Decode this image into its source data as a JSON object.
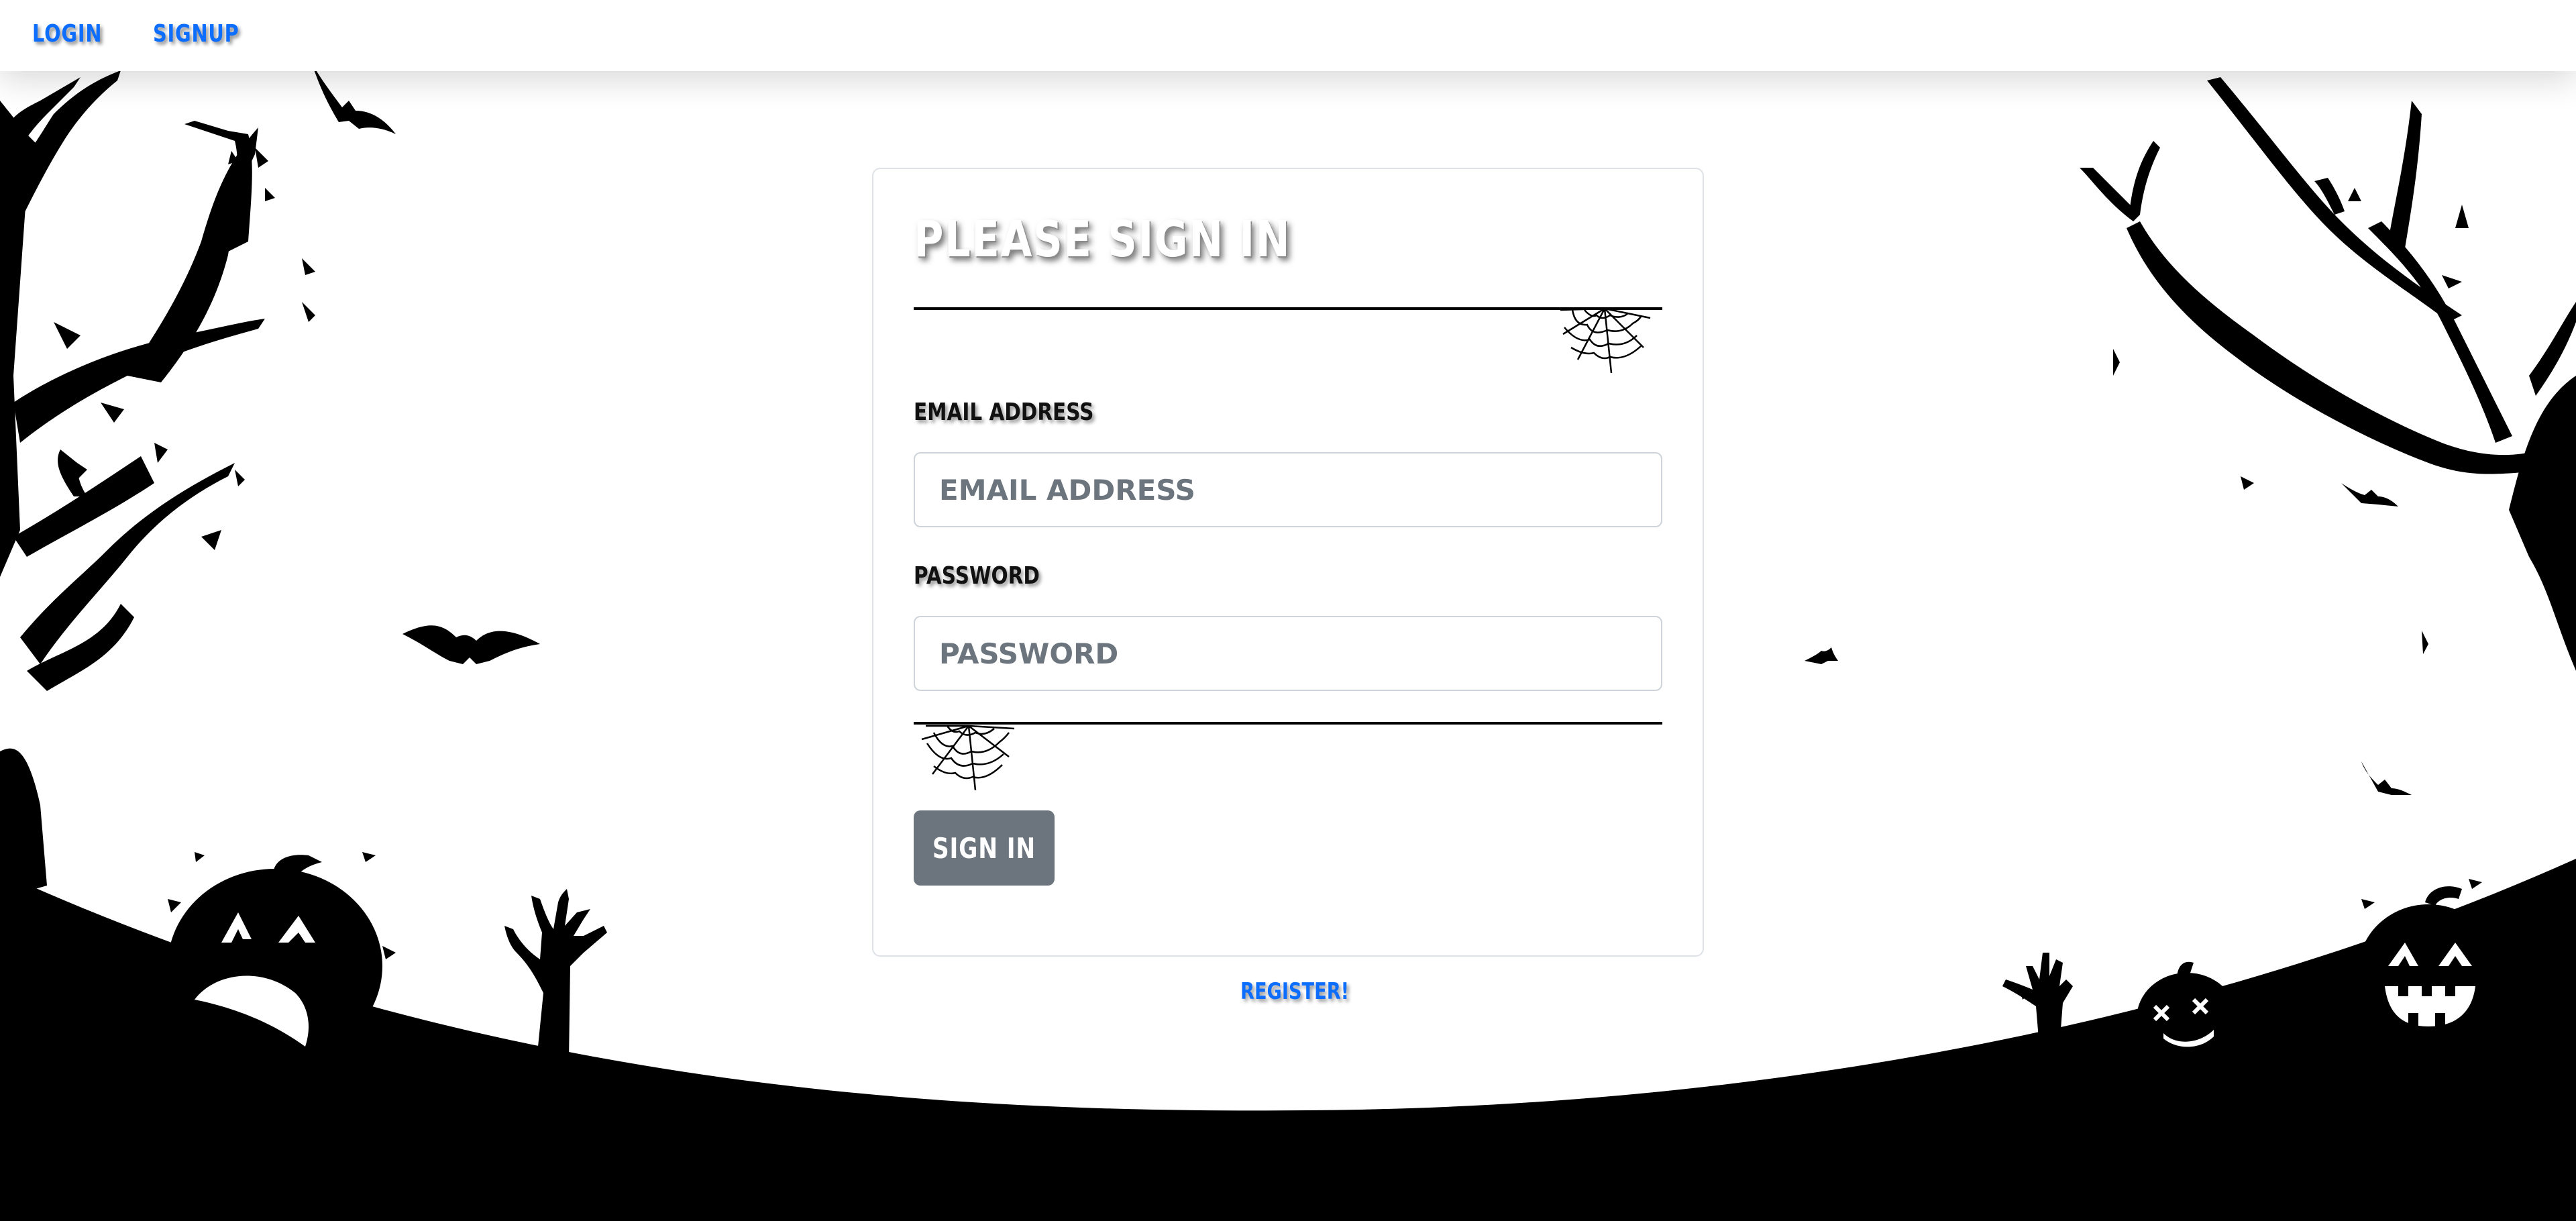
{
  "nav": {
    "login_label": "LOGIN",
    "signup_label": "SIGNUP"
  },
  "form": {
    "title": "PLEASE SIGN IN",
    "email": {
      "label": "EMAIL ADDRESS",
      "placeholder": "EMAIL ADDRESS",
      "value": ""
    },
    "password": {
      "label": "PASSWORD",
      "placeholder": "PASSWORD",
      "value": ""
    },
    "submit_label": "SIGN IN"
  },
  "register_link": "REGISTER!",
  "theme": {
    "link_color": "#0d6efd",
    "button_color": "#6c757d",
    "silhouette_color": "#000000",
    "background_color": "#ffffff"
  },
  "decorations": {
    "icons": [
      "spiderweb-icon",
      "bat-icon",
      "jack-o-lantern-icon",
      "dead-tree-icon",
      "zombie-hand-icon"
    ]
  }
}
